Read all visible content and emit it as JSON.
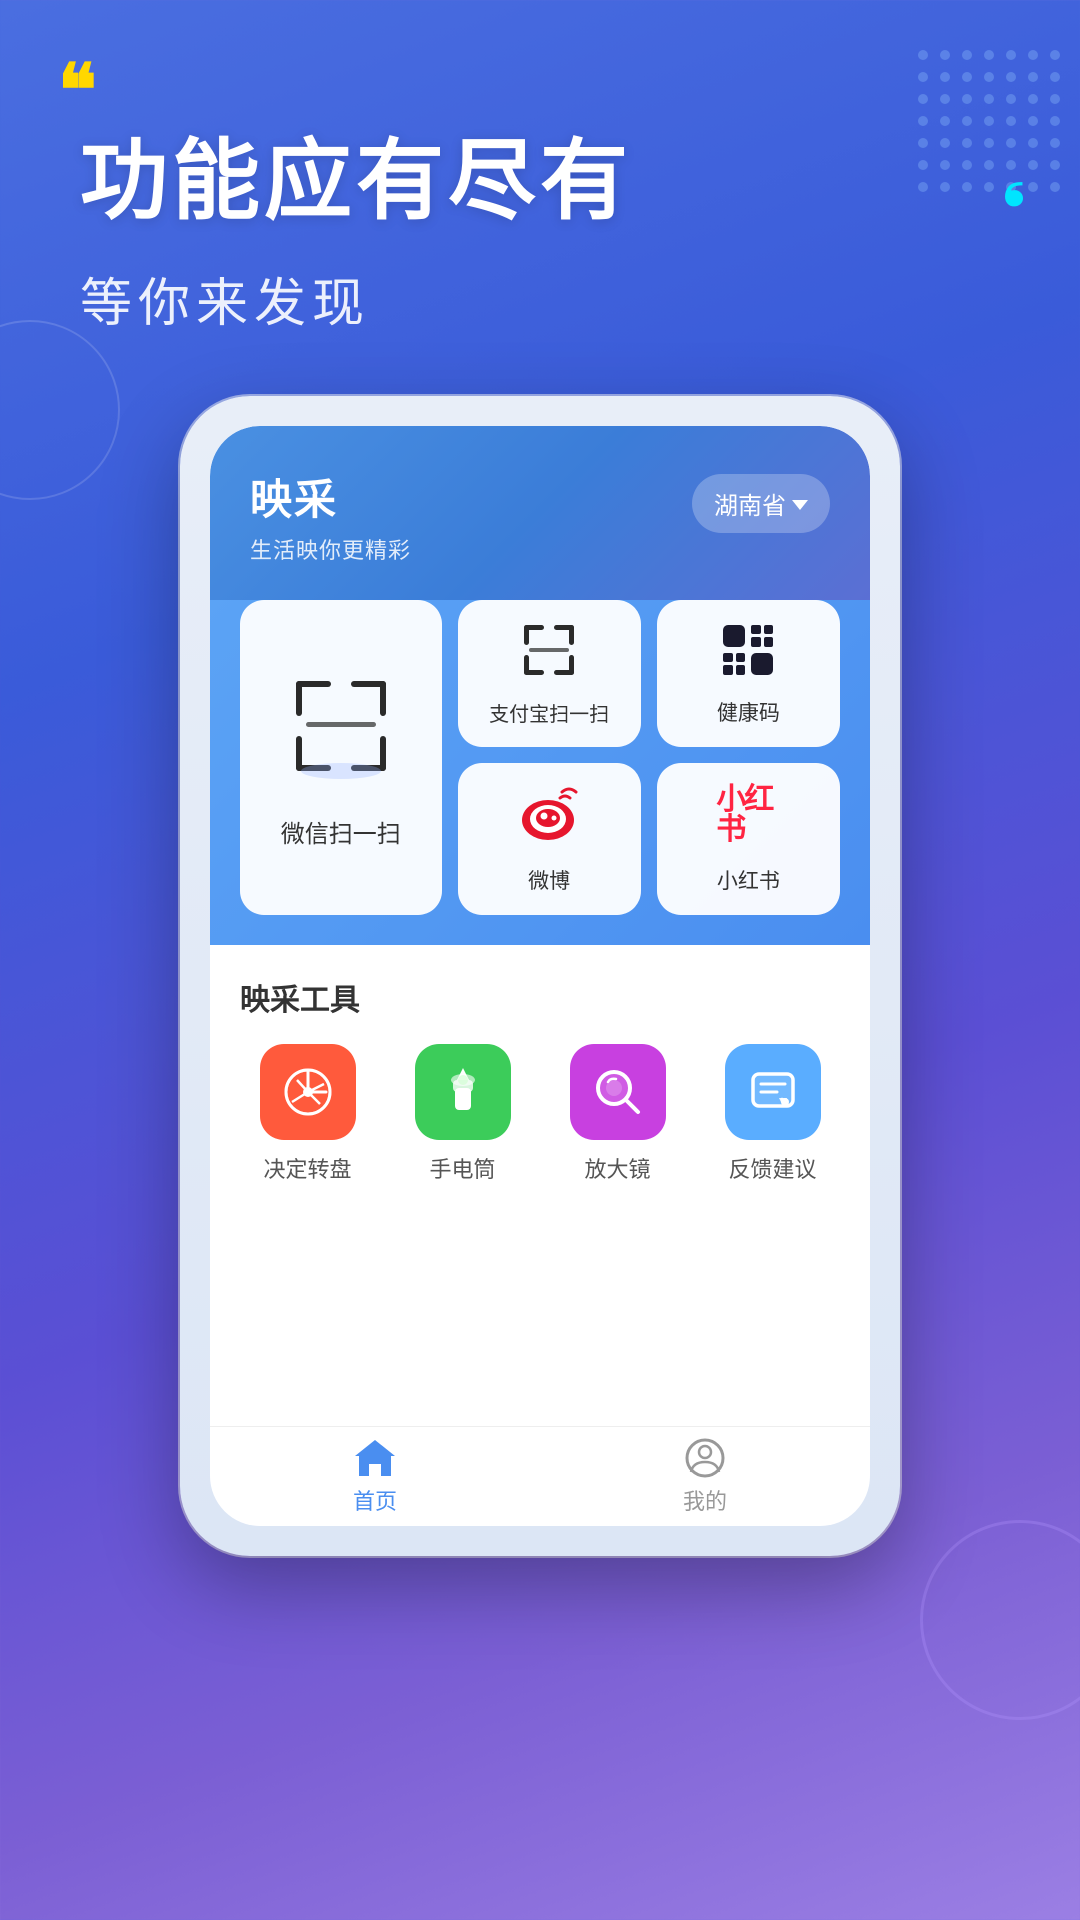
{
  "background": {
    "gradient_start": "#4a6ee0",
    "gradient_end": "#7b5fd4"
  },
  "header": {
    "main_title": "功能应有尽有",
    "sub_title": "等你来发现",
    "yellow_quote": "❝",
    "cyan_quote": "❞"
  },
  "app": {
    "logo": "映采",
    "slogan": "生活映你更精彩",
    "location": "湖南省",
    "location_dropdown": "▾"
  },
  "scan_items": [
    {
      "id": "wechat-scan",
      "label": "微信扫一扫",
      "size": "large"
    },
    {
      "id": "alipay-scan",
      "label": "支付宝扫一扫",
      "size": "small"
    },
    {
      "id": "health-code",
      "label": "健康码",
      "size": "small"
    },
    {
      "id": "weibo",
      "label": "微博",
      "size": "small"
    },
    {
      "id": "xiaohongshu",
      "label": "小红书",
      "size": "small"
    }
  ],
  "tools_section": {
    "title": "映采工具",
    "items": [
      {
        "id": "spinner",
        "label": "决定转盘",
        "color": "red",
        "icon": "spinner"
      },
      {
        "id": "flashlight",
        "label": "手电筒",
        "color": "green",
        "icon": "flashlight"
      },
      {
        "id": "magnifier",
        "label": "放大镜",
        "color": "purple",
        "icon": "magnifier"
      },
      {
        "id": "feedback",
        "label": "反馈建议",
        "color": "blue-light",
        "icon": "feedback"
      }
    ]
  },
  "bottom_nav": {
    "items": [
      {
        "id": "home",
        "label": "首页",
        "active": true
      },
      {
        "id": "mine",
        "label": "我的",
        "active": false
      }
    ]
  }
}
